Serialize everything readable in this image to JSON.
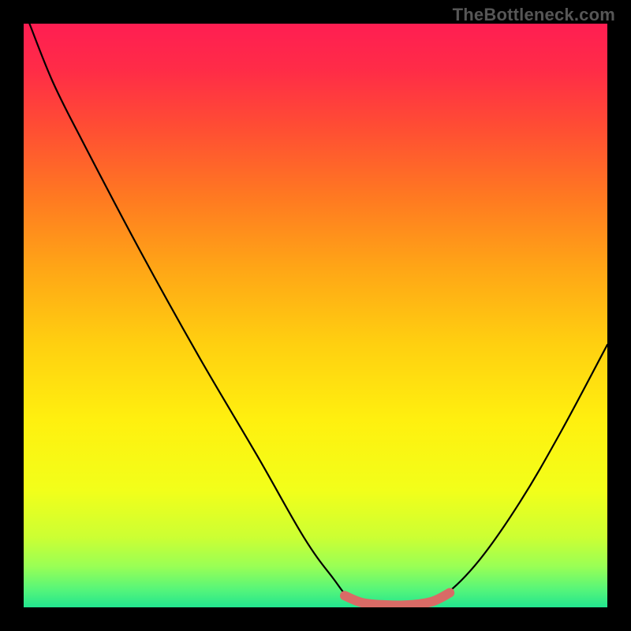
{
  "watermark": {
    "text": "TheBottleneck.com"
  },
  "gradient": {
    "stops": [
      {
        "offset": 0.0,
        "color": "#ff1e52"
      },
      {
        "offset": 0.08,
        "color": "#ff2c47"
      },
      {
        "offset": 0.18,
        "color": "#ff4e33"
      },
      {
        "offset": 0.3,
        "color": "#ff7a21"
      },
      {
        "offset": 0.42,
        "color": "#ffa616"
      },
      {
        "offset": 0.55,
        "color": "#ffd010"
      },
      {
        "offset": 0.68,
        "color": "#fff00f"
      },
      {
        "offset": 0.8,
        "color": "#f2ff1a"
      },
      {
        "offset": 0.88,
        "color": "#ccff33"
      },
      {
        "offset": 0.93,
        "color": "#99ff55"
      },
      {
        "offset": 0.97,
        "color": "#55f57a"
      },
      {
        "offset": 1.0,
        "color": "#22e58f"
      }
    ]
  },
  "chart_data": {
    "type": "line",
    "title": "",
    "xlabel": "",
    "ylabel": "",
    "xlim": [
      0,
      100
    ],
    "ylim": [
      0,
      100
    ],
    "series": [
      {
        "name": "bottleneck-curve",
        "color": "#000000",
        "points": [
          {
            "x": 1,
            "y": 100
          },
          {
            "x": 5,
            "y": 90
          },
          {
            "x": 10,
            "y": 80
          },
          {
            "x": 20,
            "y": 61
          },
          {
            "x": 30,
            "y": 43
          },
          {
            "x": 40,
            "y": 26
          },
          {
            "x": 48,
            "y": 12
          },
          {
            "x": 53,
            "y": 5
          },
          {
            "x": 56,
            "y": 1.5
          },
          {
            "x": 60,
            "y": 0.5
          },
          {
            "x": 64,
            "y": 0.3
          },
          {
            "x": 68,
            "y": 0.5
          },
          {
            "x": 72,
            "y": 2
          },
          {
            "x": 78,
            "y": 8
          },
          {
            "x": 85,
            "y": 18
          },
          {
            "x": 92,
            "y": 30
          },
          {
            "x": 100,
            "y": 45
          }
        ]
      },
      {
        "name": "highlight-optimal-range",
        "color": "#d96b66",
        "stroke_width": 12,
        "points": [
          {
            "x": 55,
            "y": 2
          },
          {
            "x": 58,
            "y": 0.8
          },
          {
            "x": 62,
            "y": 0.4
          },
          {
            "x": 66,
            "y": 0.4
          },
          {
            "x": 70,
            "y": 1
          },
          {
            "x": 73,
            "y": 2.5
          }
        ]
      }
    ]
  }
}
